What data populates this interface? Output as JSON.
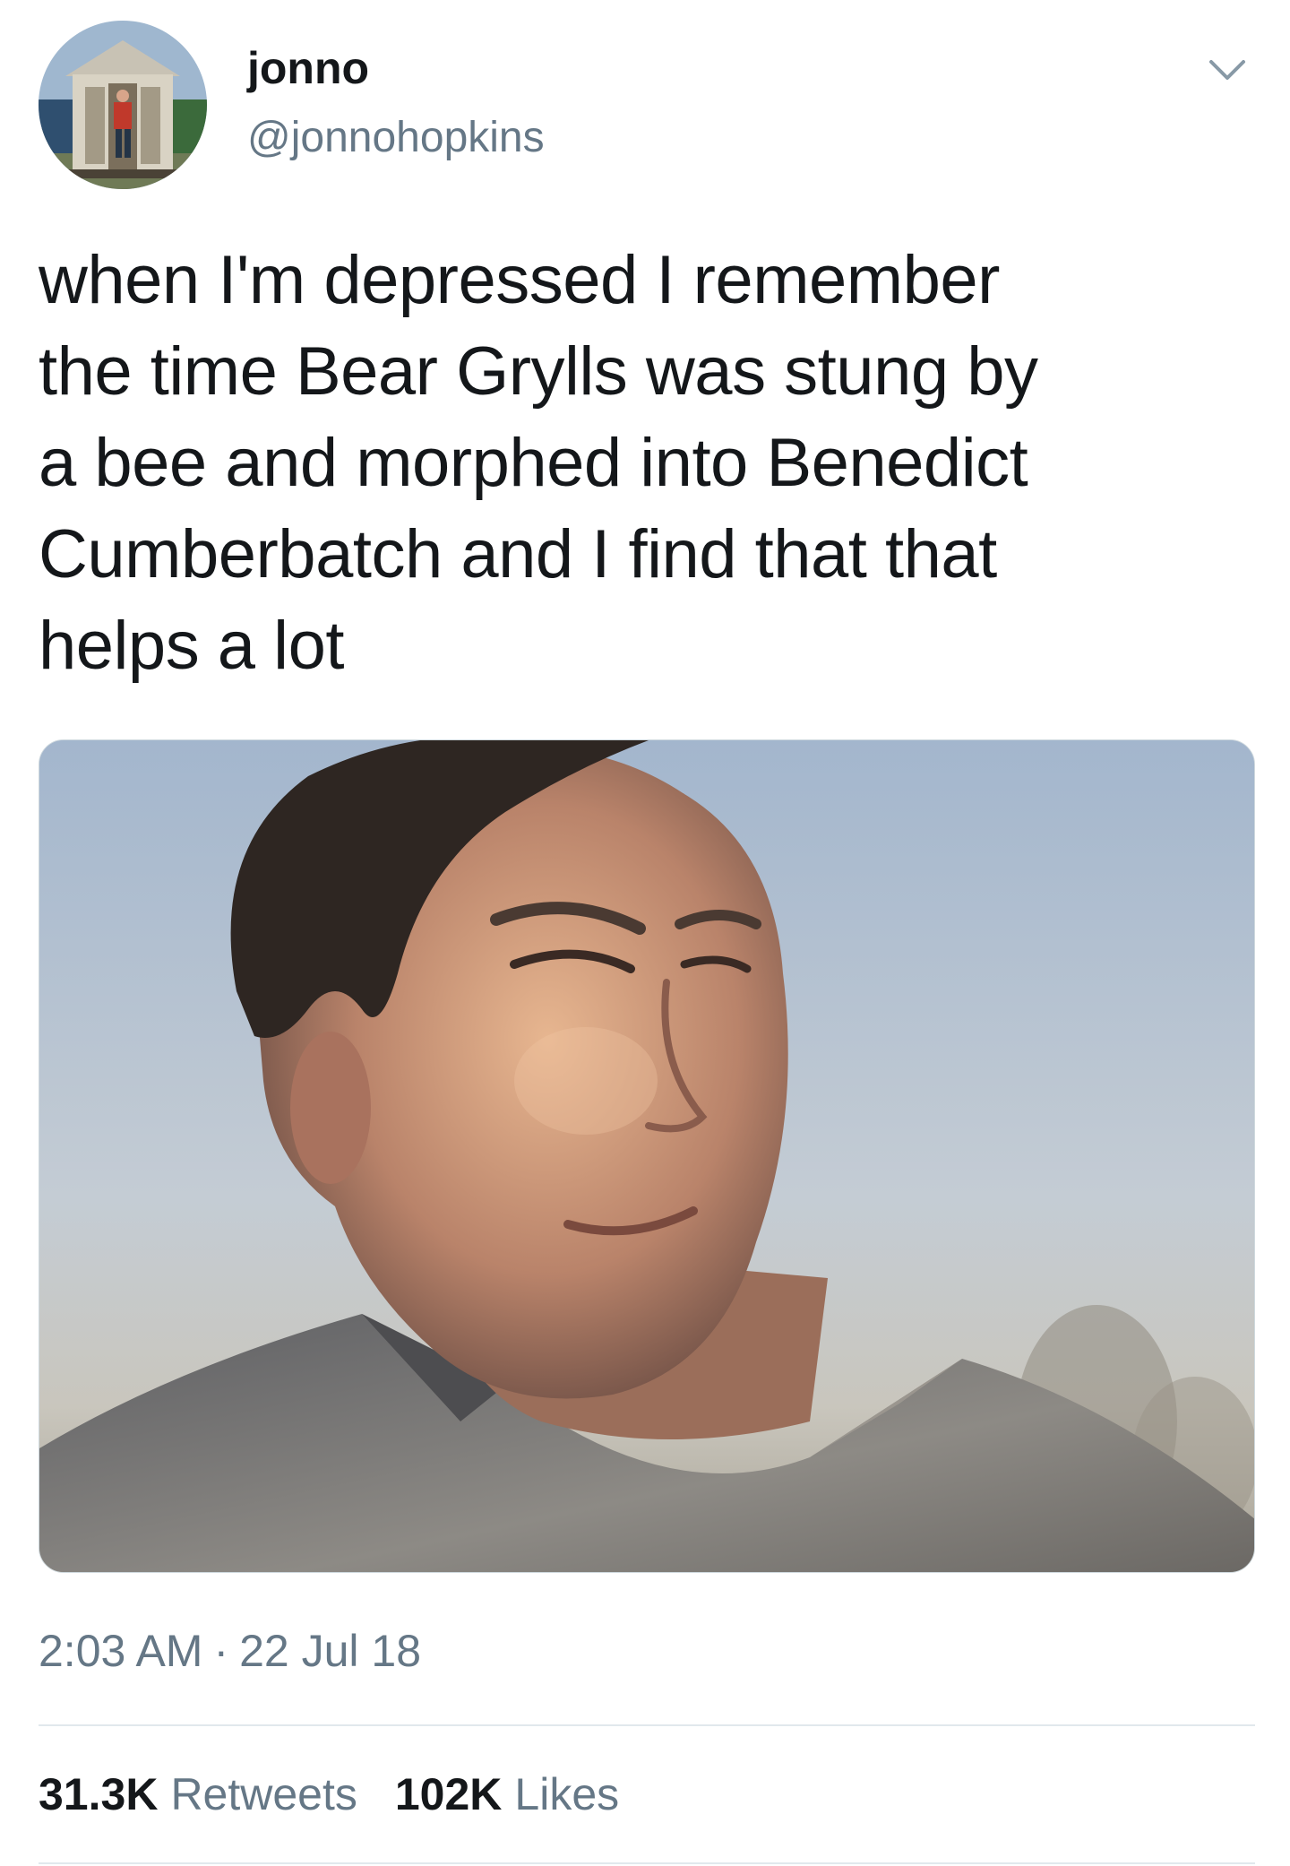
{
  "user": {
    "display_name": "jonno",
    "handle": "@jonnohopkins",
    "avatar_icon": "avatar-beach-hut-photo"
  },
  "menu_icon": "chevron-down-icon",
  "tweet": {
    "text": "when I'm depressed I remember\nthe time Bear Grylls was stung by\na bee and morphed into Benedict\nCumberbatch and I find that that\nhelps a lot",
    "media_icon": "photo-of-man-squinting"
  },
  "meta": {
    "time": "2:03 AM",
    "separator": "·",
    "date": "22 Jul 18"
  },
  "stats": {
    "retweets_count": "31.3K",
    "retweets_label": "Retweets",
    "likes_count": "102K",
    "likes_label": "Likes"
  },
  "colors": {
    "text_primary": "#14171a",
    "text_secondary": "#657786",
    "divider": "#e1e8ed"
  }
}
